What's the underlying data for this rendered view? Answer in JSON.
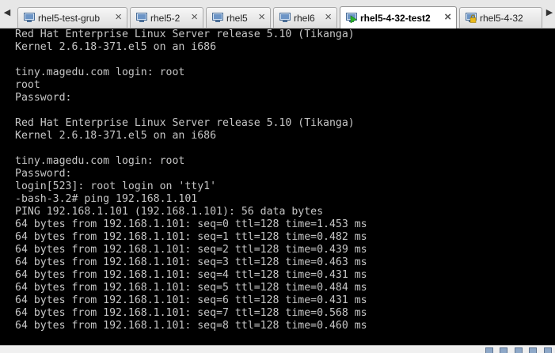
{
  "tabs": [
    {
      "label": "rhel5-test-grub",
      "icon": "vm-icon",
      "active": false
    },
    {
      "label": "rhel5-2",
      "icon": "vm-icon",
      "active": false
    },
    {
      "label": "rhel5",
      "icon": "vm-icon",
      "active": false
    },
    {
      "label": "rhel6",
      "icon": "vm-icon",
      "active": false
    },
    {
      "label": "rhel5-4-32-test2",
      "icon": "vm-running-icon",
      "active": true
    },
    {
      "label": "rhel5-4-32",
      "icon": "vm-locked-icon",
      "active": false
    }
  ],
  "close_glyph": "×",
  "colors": {
    "console_bg": "#000000",
    "console_text": "#c6c6c6",
    "running_green": "#2bb32b",
    "lock_yellow": "#e9b91a"
  },
  "console": {
    "lines": [
      "Red Hat Enterprise Linux Server release 5.10 (Tikanga)",
      "Kernel 2.6.18-371.el5 on an i686",
      "",
      "tiny.magedu.com login: root",
      "root",
      "Password:",
      "",
      "Red Hat Enterprise Linux Server release 5.10 (Tikanga)",
      "Kernel 2.6.18-371.el5 on an i686",
      "",
      "tiny.magedu.com login: root",
      "Password:",
      "login[523]: root login on 'tty1'",
      "-bash-3.2# ping 192.168.1.101",
      "PING 192.168.1.101 (192.168.1.101): 56 data bytes",
      "64 bytes from 192.168.1.101: seq=0 ttl=128 time=1.453 ms",
      "64 bytes from 192.168.1.101: seq=1 ttl=128 time=0.482 ms",
      "64 bytes from 192.168.1.101: seq=2 ttl=128 time=0.439 ms",
      "64 bytes from 192.168.1.101: seq=3 ttl=128 time=0.463 ms",
      "64 bytes from 192.168.1.101: seq=4 ttl=128 time=0.431 ms",
      "64 bytes from 192.168.1.101: seq=5 ttl=128 time=0.484 ms",
      "64 bytes from 192.168.1.101: seq=6 ttl=128 time=0.431 ms",
      "64 bytes from 192.168.1.101: seq=7 ttl=128 time=0.568 ms",
      "64 bytes from 192.168.1.101: seq=8 ttl=128 time=0.460 ms"
    ]
  }
}
